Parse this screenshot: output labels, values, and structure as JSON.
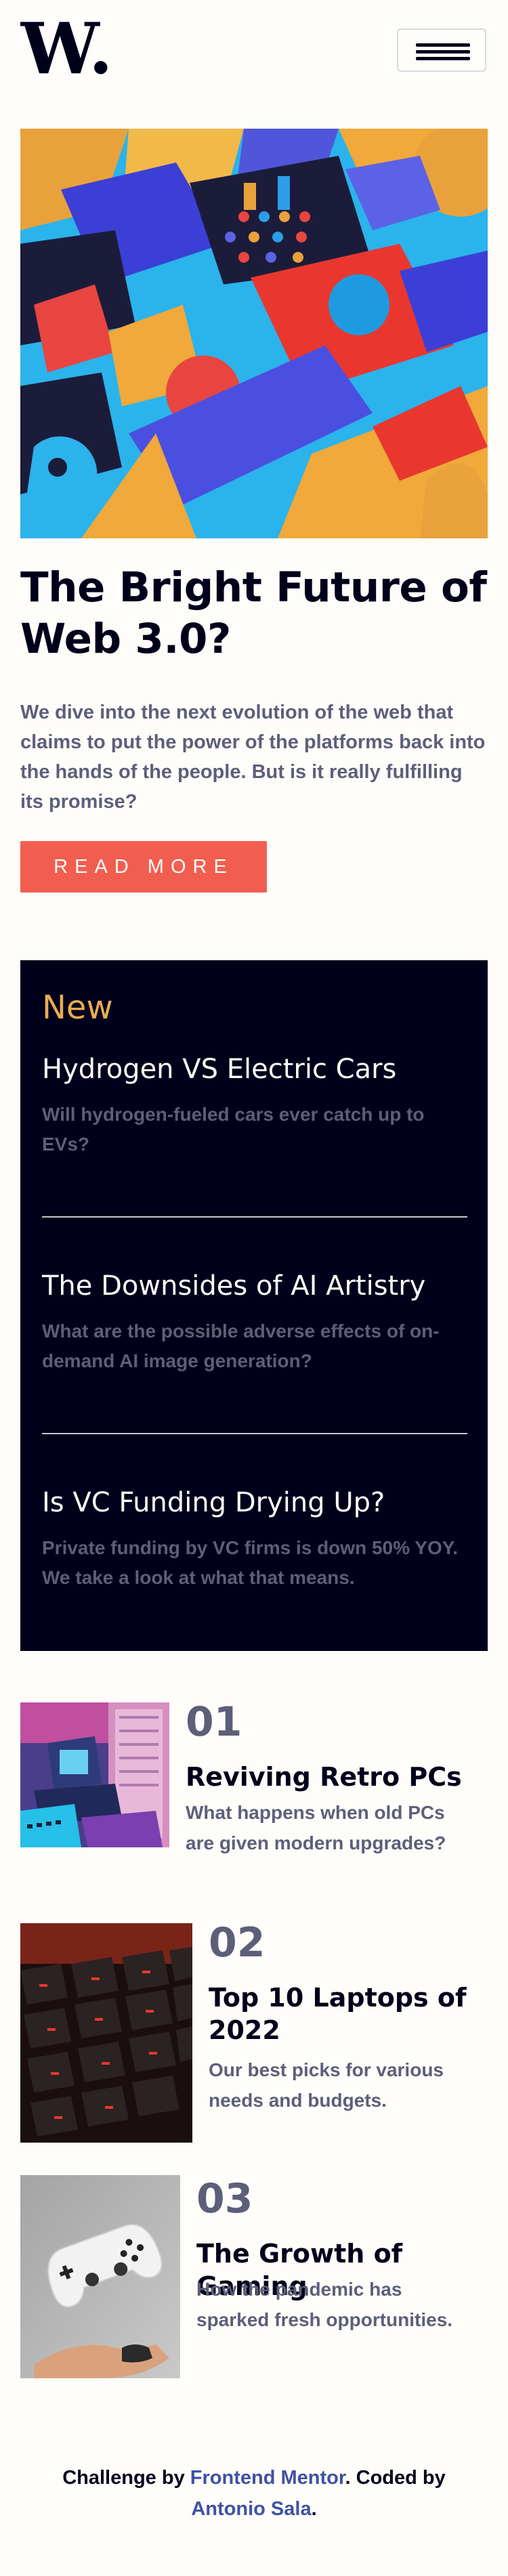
{
  "header": {
    "logo_text": "W.",
    "menu_icon": "hamburger-menu-icon"
  },
  "hero": {
    "title": "The Bright Future of Web 3.0?",
    "description": "We dive into the next evolution of the web that claims to put the power of the platforms back into the hands of the people. But is it really fulfilling its promise?",
    "button_label": "READ MORE"
  },
  "new_panel": {
    "heading": "New",
    "items": [
      {
        "title": "Hydrogen VS Electric Cars",
        "description": "Will hydrogen-fueled cars ever catch up to EVs?"
      },
      {
        "title": "The Downsides of AI Artistry",
        "description": "What are the possible adverse effects of on-demand AI image generation?"
      },
      {
        "title": "Is VC Funding Drying Up?",
        "description": "Private funding by VC firms is down 50% YOY. We take a look at what that means."
      }
    ]
  },
  "trending": [
    {
      "number": "01",
      "title": "Reviving Retro PCs",
      "description": "What happens when old PCs are given modern upgrades?"
    },
    {
      "number": "02",
      "title": "Top 10 Laptops of 2022",
      "description": "Our best picks for various needs and budgets."
    },
    {
      "number": "03",
      "title": "The Growth of Gaming",
      "description": "How the pandemic has sparked fresh opportunities."
    }
  ],
  "footer": {
    "prefix": "Challenge by ",
    "challenge_link": "Frontend Mentor",
    "middle": ". Coded by ",
    "author_link": "Antonio Sala",
    "suffix": "."
  },
  "colors": {
    "accent": "#f15e50",
    "dark": "#00001a",
    "muted": "#5d5f79",
    "gold": "#e9ab53",
    "link": "#3e52a3",
    "background": "#fffdfa"
  }
}
